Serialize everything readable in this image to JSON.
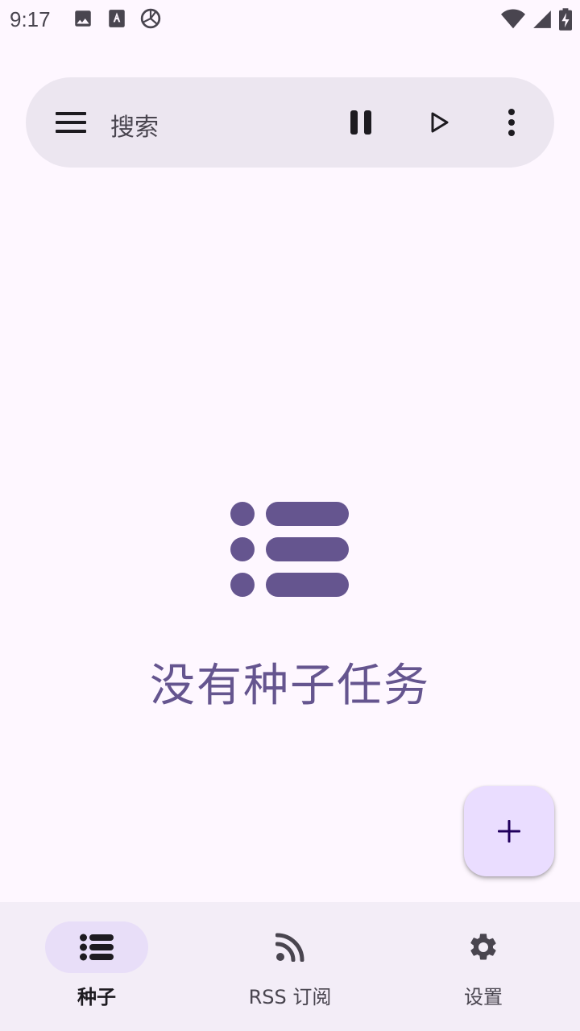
{
  "status_bar": {
    "time": "9:17",
    "left_icons": [
      "image-icon",
      "text-a-icon",
      "sync-icon"
    ],
    "right_icons": [
      "wifi-icon",
      "signal-icon",
      "battery-charging-icon"
    ]
  },
  "search_bar": {
    "placeholder": "搜索",
    "actions": [
      "menu-icon",
      "pause-icon",
      "play-icon",
      "more-vert-icon"
    ]
  },
  "empty_state": {
    "icon": "list-icon",
    "message": "没有种子任务"
  },
  "fab": {
    "icon": "add-icon"
  },
  "bottom_nav": {
    "items": [
      {
        "label": "种子",
        "icon": "list-icon",
        "active": true
      },
      {
        "label": "RSS 订阅",
        "icon": "rss-icon",
        "active": false
      },
      {
        "label": "设置",
        "icon": "gear-icon",
        "active": false
      }
    ]
  },
  "colors": {
    "background": "#FEF7FF",
    "search_bar": "#ECE6F0",
    "accent": "#65558F",
    "fab": "#EADDFF",
    "nav_background": "#F3EDF7",
    "nav_active_pill": "#E8DEF8"
  }
}
